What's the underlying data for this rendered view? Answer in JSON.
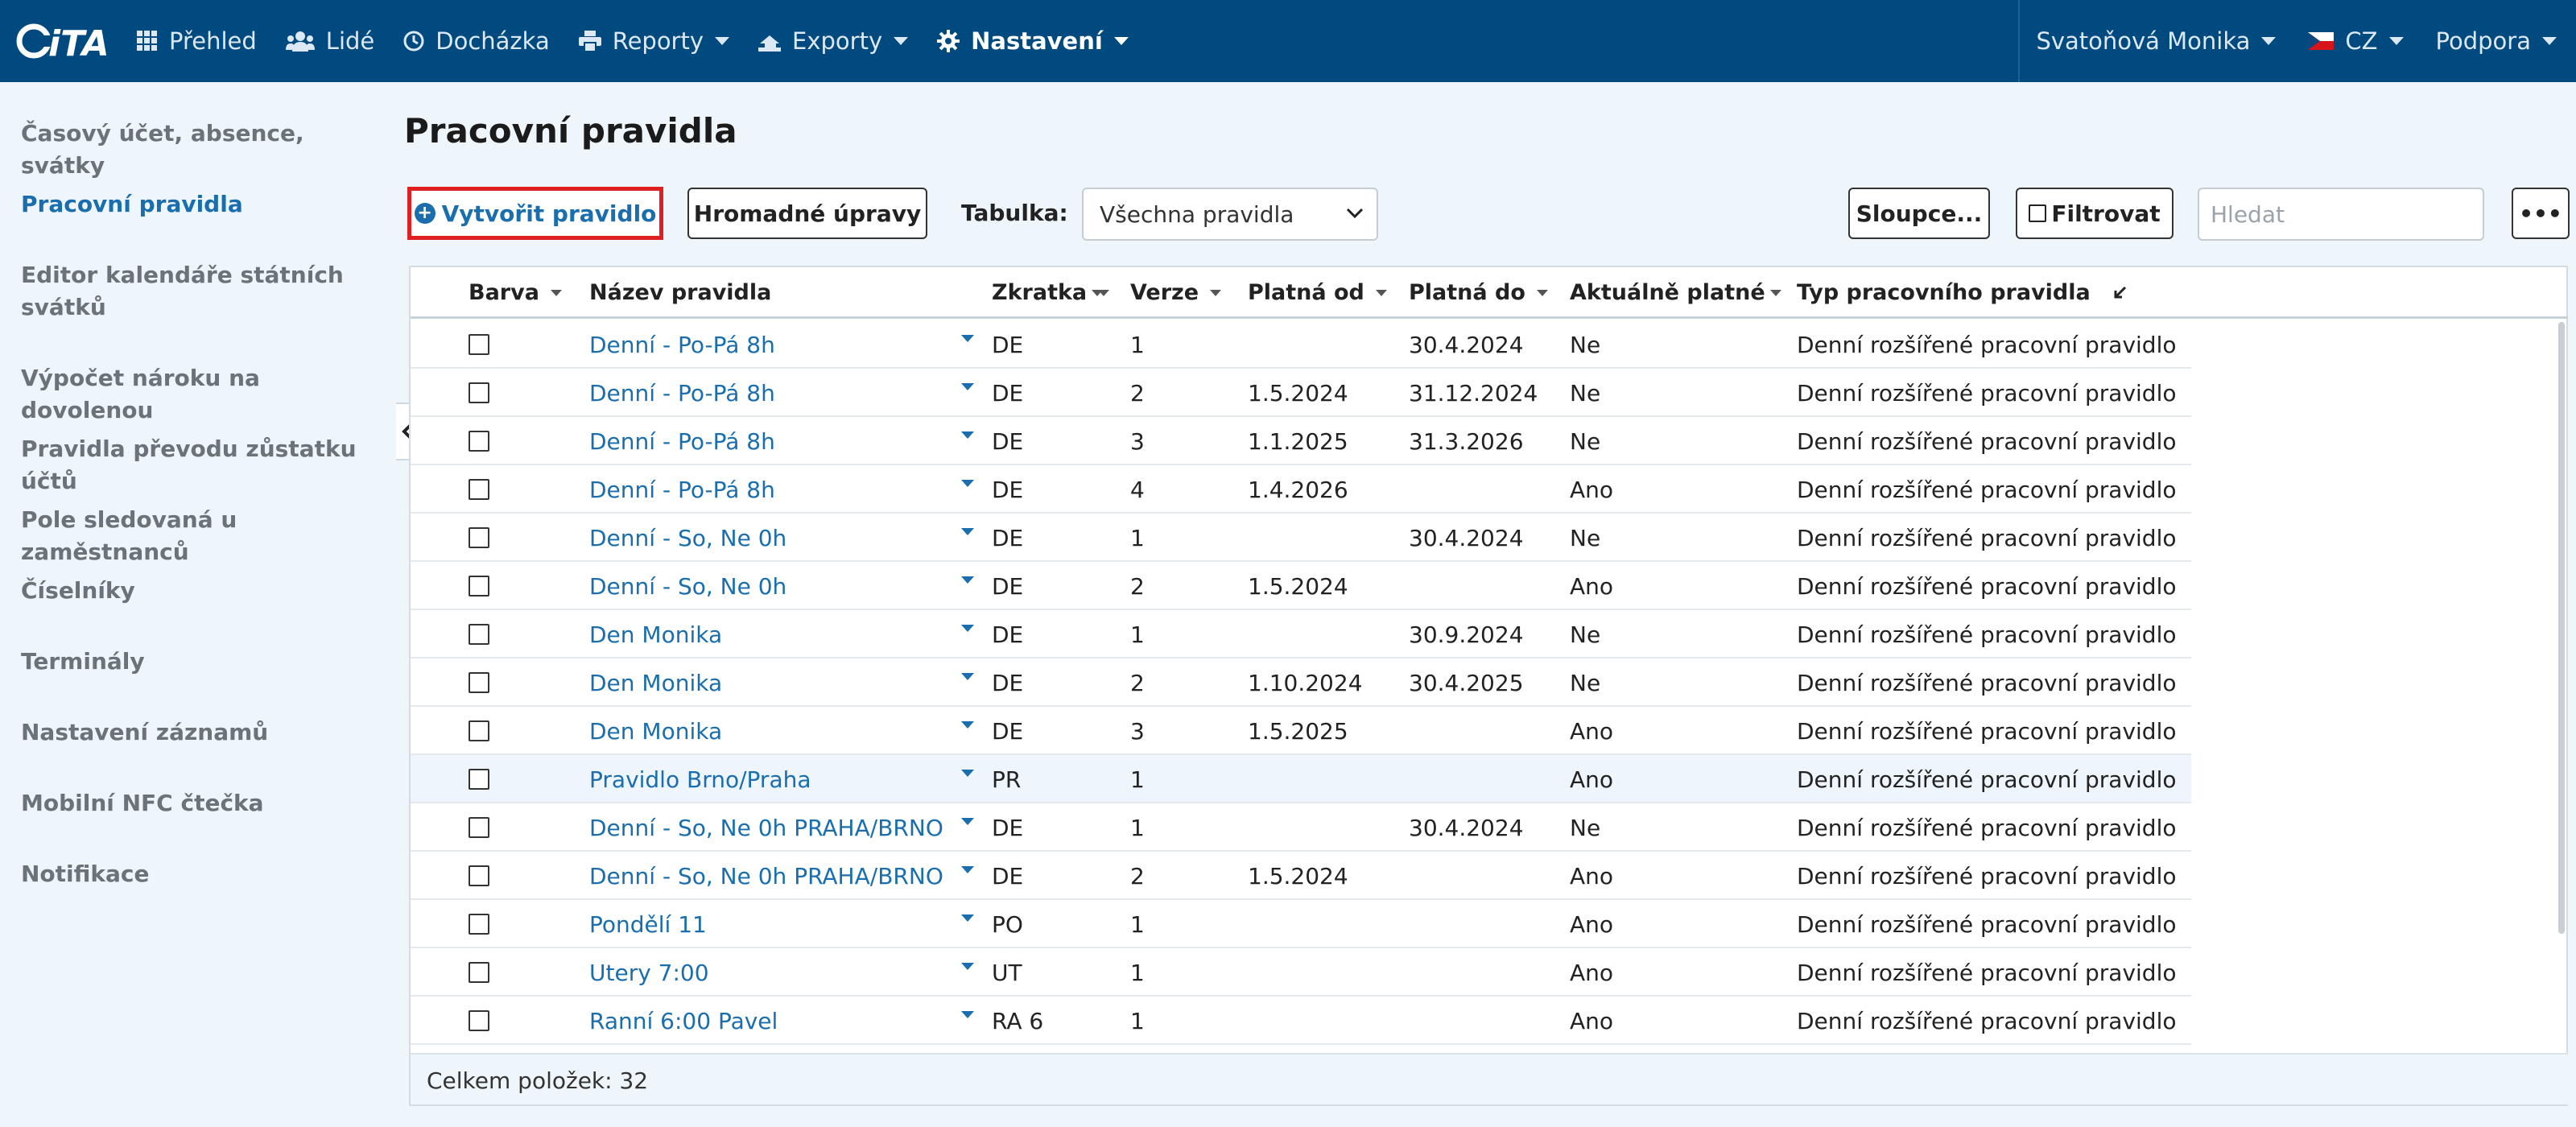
{
  "nav": {
    "logo_text": "CITA",
    "items": [
      {
        "label": "Přehled",
        "icon": "grid-icon"
      },
      {
        "label": "Lidé",
        "icon": "users-icon"
      },
      {
        "label": "Docházka",
        "icon": "clock-icon"
      },
      {
        "label": "Reporty",
        "icon": "print-icon"
      },
      {
        "label": "Exporty",
        "icon": "export-icon"
      },
      {
        "label": "Nastavení",
        "icon": "gear-icon"
      }
    ],
    "user": "Svatoňová Monika",
    "language": "CZ",
    "support": "Podpora",
    "colors": {
      "navbar": "#004a7f",
      "link": "#1a6eae",
      "highlight": "#e02020"
    }
  },
  "sidebar": {
    "items": [
      {
        "label": "Časový účet, absence, svátky"
      },
      {
        "label": "Pracovní pravidla"
      },
      {
        "label": "Editor kalendáře státních"
      },
      {
        "label": "svátků"
      },
      {
        "label": "Výpočet nároku na dovolenou"
      },
      {
        "label": "Pravidla převodu zůstatku účtů"
      },
      {
        "label": "Pole sledovaná u zaměstnanců"
      },
      {
        "label": "Číselníky"
      },
      {
        "label": "Terminály"
      },
      {
        "label": "Nastavení záznamů"
      },
      {
        "label": "Mobilní NFC čtečka"
      },
      {
        "label": "Notifikace"
      }
    ]
  },
  "main": {
    "title": "Pracovní pravidla",
    "create_button": "Vytvořit pravidlo",
    "bulk_button": "Hromadné úpravy",
    "table_label": "Tabulka:",
    "table_select": "Všechna pravidla",
    "columns_button": "Sloupce...",
    "filter_button": "Filtrovat",
    "search_placeholder": "Hledat",
    "more_button": "•••"
  },
  "table": {
    "headers": [
      "Barva",
      "Název pravidla",
      "Zkratka",
      "Verze",
      "Platná od",
      "Platná do",
      "Aktuálně platné",
      "Typ pracovního pravidla"
    ],
    "rows": [
      {
        "name": "Denní - Po-Pá 8h",
        "abbr": "DE",
        "version": "1",
        "from": "",
        "to": "30.4.2024",
        "current": "Ne",
        "type": "Denní rozšířené pracovní pravidlo"
      },
      {
        "name": "Denní - Po-Pá 8h",
        "abbr": "DE",
        "version": "2",
        "from": "1.5.2024",
        "to": "31.12.2024",
        "current": "Ne",
        "type": "Denní rozšířené pracovní pravidlo"
      },
      {
        "name": "Denní - Po-Pá 8h",
        "abbr": "DE",
        "version": "3",
        "from": "1.1.2025",
        "to": "31.3.2026",
        "current": "Ne",
        "type": "Denní rozšířené pracovní pravidlo"
      },
      {
        "name": "Denní - Po-Pá 8h",
        "abbr": "DE",
        "version": "4",
        "from": "1.4.2026",
        "to": "",
        "current": "Ano",
        "type": "Denní rozšířené pracovní pravidlo"
      },
      {
        "name": "Denní - So, Ne 0h",
        "abbr": "DE",
        "version": "1",
        "from": "",
        "to": "30.4.2024",
        "current": "Ne",
        "type": "Denní rozšířené pracovní pravidlo"
      },
      {
        "name": "Denní - So, Ne 0h",
        "abbr": "DE",
        "version": "2",
        "from": "1.5.2024",
        "to": "",
        "current": "Ano",
        "type": "Denní rozšířené pracovní pravidlo"
      },
      {
        "name": "Den Monika",
        "abbr": "DE",
        "version": "1",
        "from": "",
        "to": "30.9.2024",
        "current": "Ne",
        "type": "Denní rozšířené pracovní pravidlo"
      },
      {
        "name": "Den Monika",
        "abbr": "DE",
        "version": "2",
        "from": "1.10.2024",
        "to": "30.4.2025",
        "current": "Ne",
        "type": "Denní rozšířené pracovní pravidlo"
      },
      {
        "name": "Den Monika",
        "abbr": "DE",
        "version": "3",
        "from": "1.5.2025",
        "to": "",
        "current": "Ano",
        "type": "Denní rozšířené pracovní pravidlo"
      },
      {
        "name": "Pravidlo Brno/Praha",
        "abbr": "PR",
        "version": "1",
        "from": "",
        "to": "",
        "current": "Ano",
        "type": "Denní rozšířené pracovní pravidlo"
      },
      {
        "name": "Denní - So, Ne 0h PRAHA/BRNO",
        "abbr": "DE",
        "version": "1",
        "from": "",
        "to": "30.4.2024",
        "current": "Ne",
        "type": "Denní rozšířené pracovní pravidlo"
      },
      {
        "name": "Denní - So, Ne 0h PRAHA/BRNO",
        "abbr": "DE",
        "version": "2",
        "from": "1.5.2024",
        "to": "",
        "current": "Ano",
        "type": "Denní rozšířené pracovní pravidlo"
      },
      {
        "name": "Pondělí 11",
        "abbr": "PO",
        "version": "1",
        "from": "",
        "to": "",
        "current": "Ano",
        "type": "Denní rozšířené pracovní pravidlo"
      },
      {
        "name": "Utery 7:00",
        "abbr": "UT",
        "version": "1",
        "from": "",
        "to": "",
        "current": "Ano",
        "type": "Denní rozšířené pracovní pravidlo"
      },
      {
        "name": "Ranní 6:00 Pavel",
        "abbr": "RA 6",
        "version": "1",
        "from": "",
        "to": "",
        "current": "Ano",
        "type": "Denní rozšířené pracovní pravidlo"
      }
    ],
    "footer": "Celkem položek: 32"
  }
}
